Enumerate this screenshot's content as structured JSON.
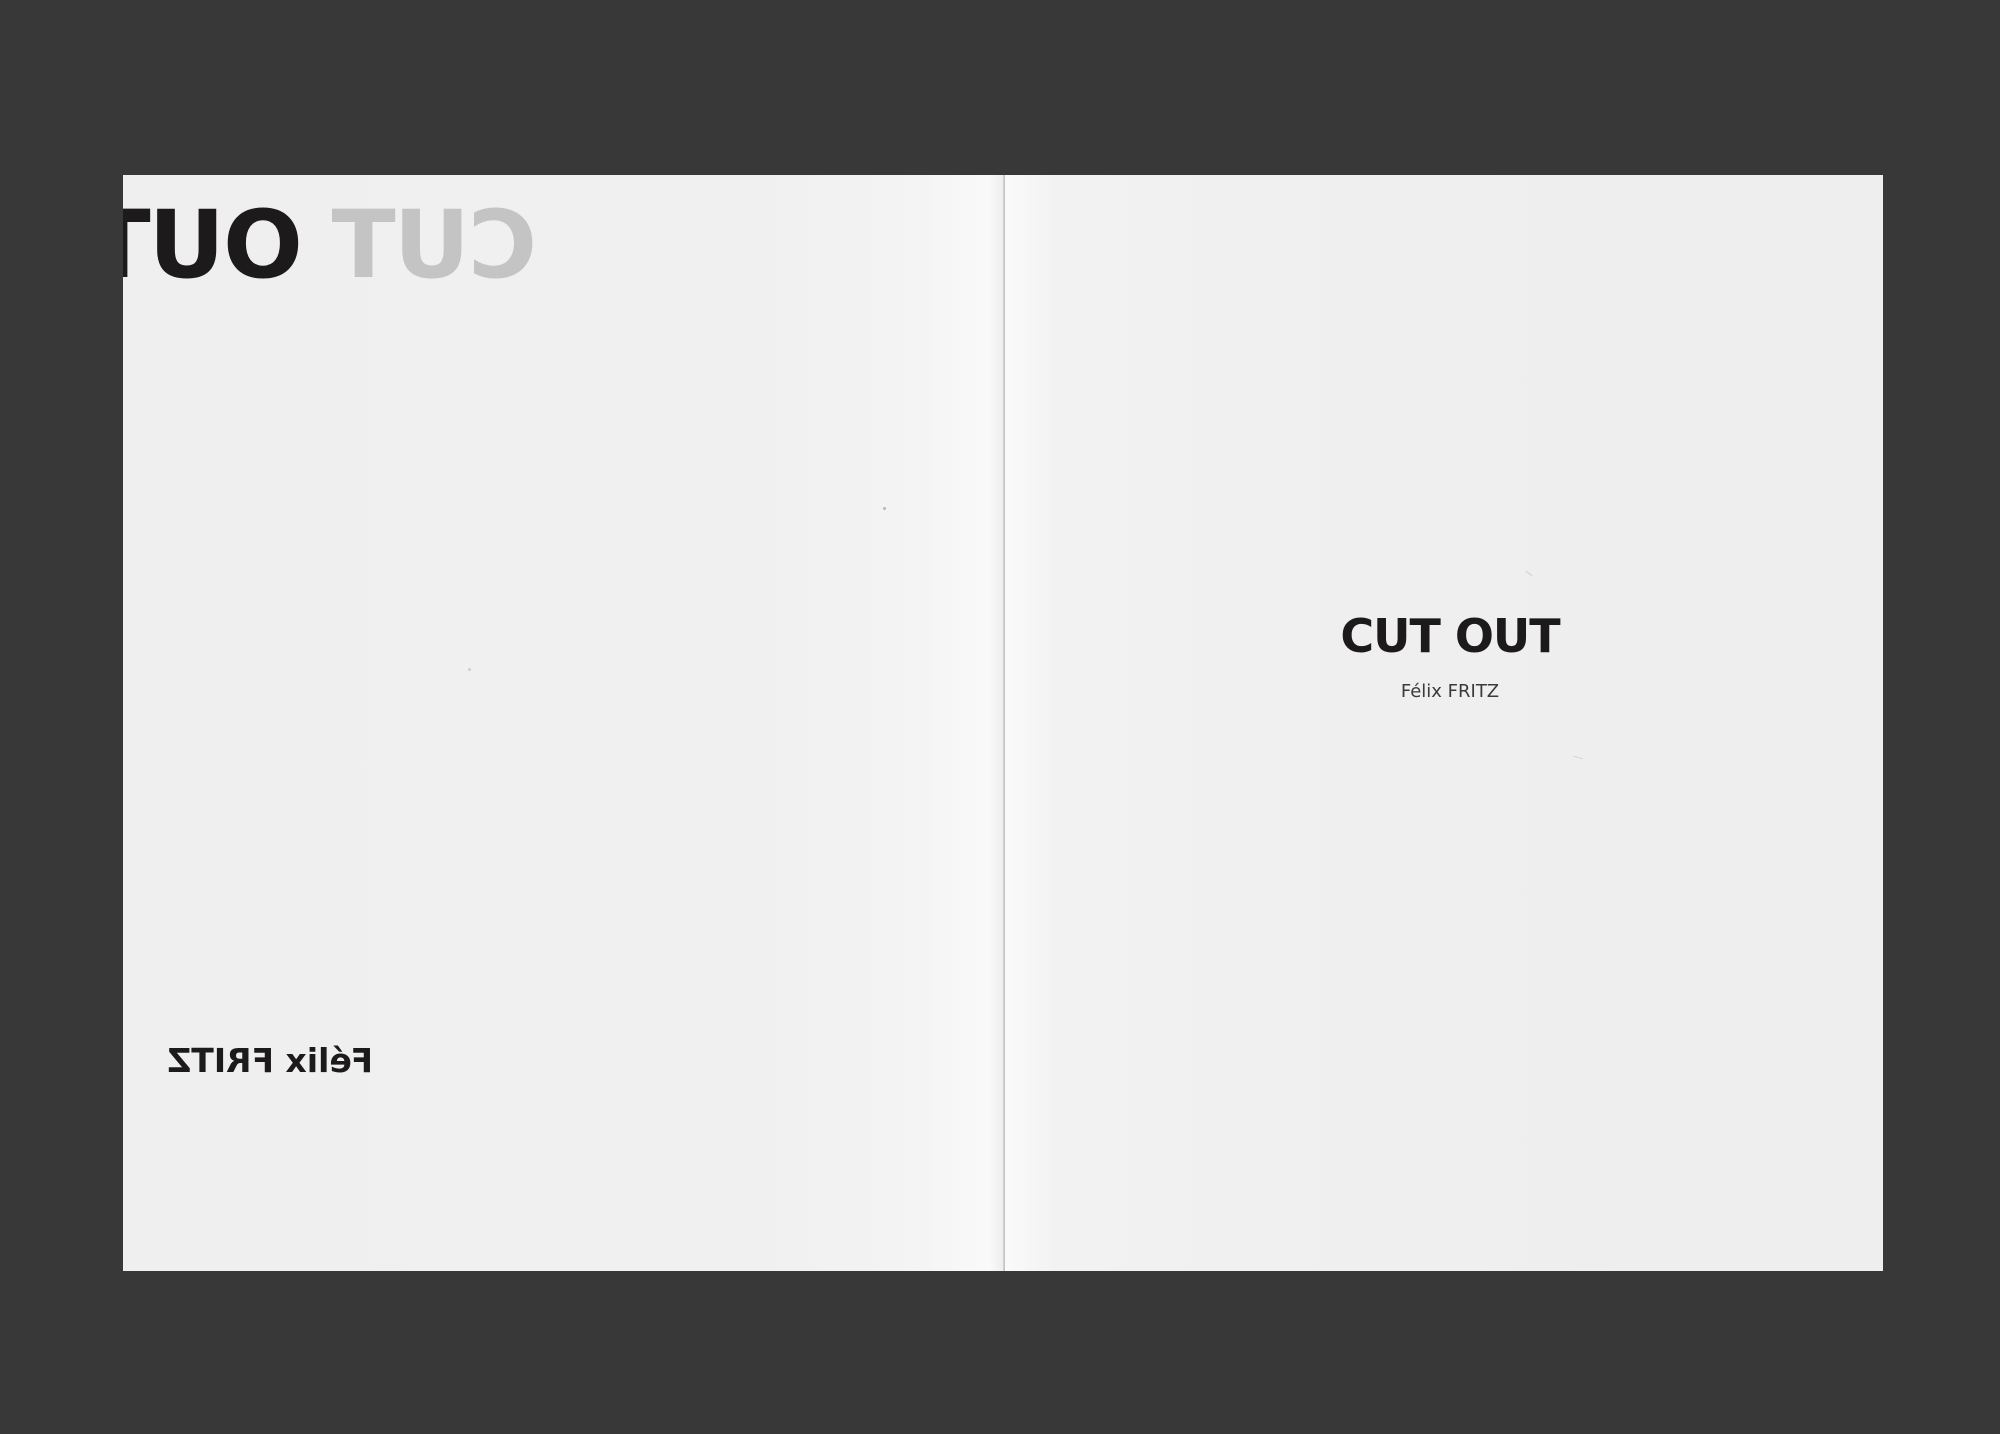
{
  "left_page": {
    "title_word_out": "OUT",
    "title_word_cut": "CUT",
    "author": "Félix FRITZ"
  },
  "right_page": {
    "title": "CUT OUT",
    "author": "Félix FRITZ"
  },
  "colors": {
    "background": "#383838",
    "paper": "#f0f0f0",
    "ink": "#1c1a1b",
    "faded_ink": "#c4c4c4"
  }
}
